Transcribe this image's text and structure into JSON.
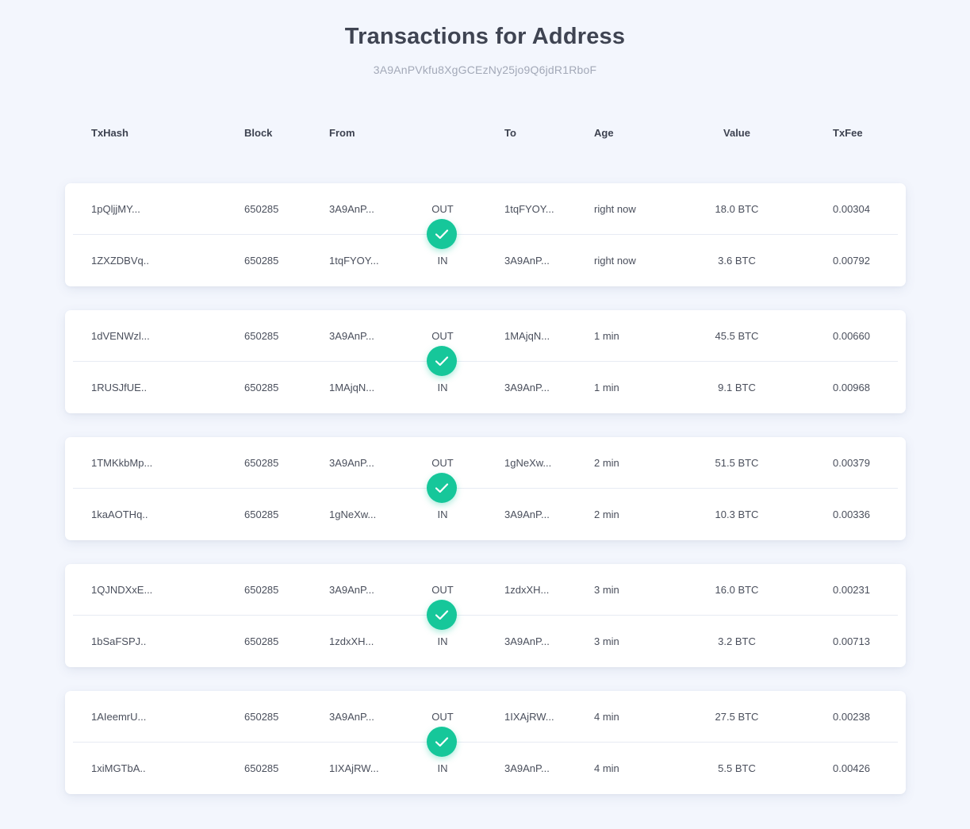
{
  "page": {
    "title": "Transactions for Address",
    "address": "3A9AnPVkfu8XgGCEzNy25jo9Q6jdR1RboF"
  },
  "columns": {
    "txhash": "TxHash",
    "block": "Block",
    "from": "From",
    "to": "To",
    "age": "Age",
    "value": "Value",
    "txfee": "TxFee"
  },
  "colors": {
    "background": "#f3f6fd",
    "card": "#ffffff",
    "confirmed_check": "#16c79a"
  },
  "groups": [
    {
      "status_icon": "check-circle-icon",
      "out": {
        "hash": "1pQljjMY...",
        "block": "650285",
        "from": "3A9AnP...",
        "direction": "OUT",
        "to": "1tqFYOY...",
        "age": "right now",
        "value": "18.0 BTC",
        "fee": "0.00304"
      },
      "in": {
        "hash": "1ZXZDBVq..",
        "block": "650285",
        "from": "1tqFYOY...",
        "direction": "IN",
        "to": "3A9AnP...",
        "age": "right now",
        "value": "3.6 BTC",
        "fee": "0.00792"
      }
    },
    {
      "status_icon": "check-circle-icon",
      "out": {
        "hash": "1dVENWzl...",
        "block": "650285",
        "from": "3A9AnP...",
        "direction": "OUT",
        "to": "1MAjqN...",
        "age": "1 min",
        "value": "45.5 BTC",
        "fee": "0.00660"
      },
      "in": {
        "hash": "1RUSJfUE..",
        "block": "650285",
        "from": "1MAjqN...",
        "direction": "IN",
        "to": "3A9AnP...",
        "age": "1 min",
        "value": "9.1 BTC",
        "fee": "0.00968"
      }
    },
    {
      "status_icon": "check-circle-icon",
      "out": {
        "hash": "1TMKkbMp...",
        "block": "650285",
        "from": "3A9AnP...",
        "direction": "OUT",
        "to": "1gNeXw...",
        "age": "2 min",
        "value": "51.5 BTC",
        "fee": "0.00379"
      },
      "in": {
        "hash": "1kaAOTHq..",
        "block": "650285",
        "from": "1gNeXw...",
        "direction": "IN",
        "to": "3A9AnP...",
        "age": "2 min",
        "value": "10.3 BTC",
        "fee": "0.00336"
      }
    },
    {
      "status_icon": "check-circle-icon",
      "out": {
        "hash": "1QJNDXxE...",
        "block": "650285",
        "from": "3A9AnP...",
        "direction": "OUT",
        "to": "1zdxXH...",
        "age": "3 min",
        "value": "16.0 BTC",
        "fee": "0.00231"
      },
      "in": {
        "hash": "1bSaFSPJ..",
        "block": "650285",
        "from": "1zdxXH...",
        "direction": "IN",
        "to": "3A9AnP...",
        "age": "3 min",
        "value": "3.2 BTC",
        "fee": "0.00713"
      }
    },
    {
      "status_icon": "check-circle-icon",
      "out": {
        "hash": "1AIeemrU...",
        "block": "650285",
        "from": "3A9AnP...",
        "direction": "OUT",
        "to": "1IXAjRW...",
        "age": "4 min",
        "value": "27.5 BTC",
        "fee": "0.00238"
      },
      "in": {
        "hash": "1xiMGTbA..",
        "block": "650285",
        "from": "1IXAjRW...",
        "direction": "IN",
        "to": "3A9AnP...",
        "age": "4 min",
        "value": "5.5 BTC",
        "fee": "0.00426"
      }
    }
  ]
}
